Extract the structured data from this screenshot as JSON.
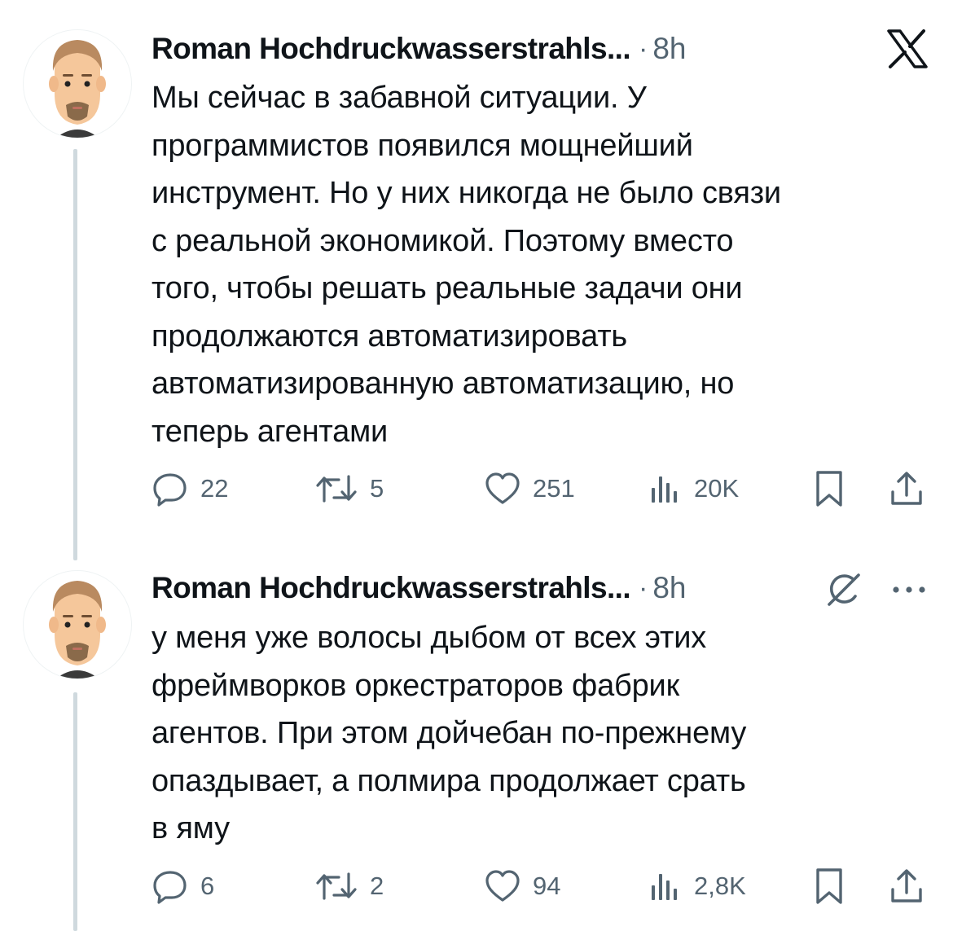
{
  "tweets": [
    {
      "author": "Roman Hochdruckwasserstrahls...",
      "separator": "·",
      "time": "8h",
      "text": "Мы сейчас в забавной ситуации. У\nпрограммистов появился мощнейший\nинструмент. Но у них никогда не было связи\nс реальной экономикой. Поэтому вместо\nтого, чтобы решать реальные задачи они\nпродолжаются автоматизировать\nавтоматизированную автоматизацию, но\nтеперь агентами",
      "stats": {
        "replies": "22",
        "reposts": "5",
        "likes": "251",
        "views": "20K"
      },
      "corner_icon": "x-logo-icon"
    },
    {
      "author": "Roman Hochdruckwasserstrahls...",
      "separator": "·",
      "time": "8h",
      "text": "у меня уже волосы дыбом от всех этих\nфреймворков оркестраторов фабрик\nагентов. При этом дойчебан по-прежнему\nопаздывает, а полмира продолжает срать\nв яму",
      "stats": {
        "replies": "6",
        "reposts": "2",
        "likes": "94",
        "views": "2,8K"
      },
      "corner_icon": "grok-icon"
    }
  ],
  "icons": {
    "reply": "reply-icon",
    "repost": "repost-icon",
    "like": "heart-icon",
    "views": "views-icon",
    "bookmark": "bookmark-icon",
    "share": "share-icon",
    "more": "more-icon"
  },
  "colors": {
    "text": "#0f1419",
    "secondary": "#536471",
    "thread_line": "#cfd9de",
    "background": "#ffffff"
  }
}
